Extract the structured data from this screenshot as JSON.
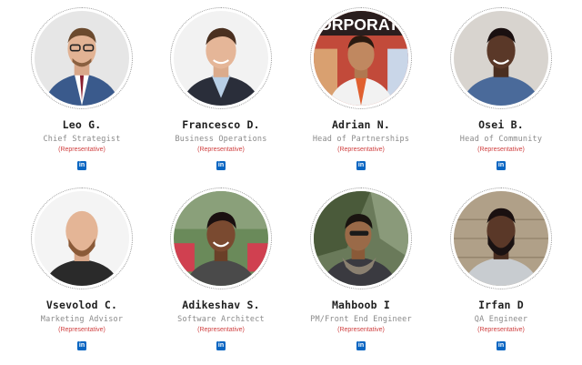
{
  "team": [
    {
      "name": "Leo G.",
      "role": "Chief Strategist",
      "badge": "(Representative)",
      "social": "in"
    },
    {
      "name": "Francesco D.",
      "role": "Business Operations",
      "badge": "(Representative)",
      "social": "in"
    },
    {
      "name": "Adrian N.",
      "role": "Head of Partnerships",
      "badge": "(Representative)",
      "social": "in",
      "photo_text": "ORPORATI"
    },
    {
      "name": "Osei B.",
      "role": "Head of Community",
      "badge": "(Representative)",
      "social": "in"
    },
    {
      "name": "Vsevolod C.",
      "role": "Marketing Advisor",
      "badge": "(Representative)",
      "social": "in"
    },
    {
      "name": "Adikeshav S.",
      "role": "Software Architect",
      "badge": "(Representative)",
      "social": "in"
    },
    {
      "name": "Mahboob I",
      "role": "PM/Front End Engineer",
      "badge": "(Representative)",
      "social": "in"
    },
    {
      "name": "Irfan D",
      "role": "QA Engineer",
      "badge": "(Representative)",
      "social": "in"
    }
  ],
  "colors": {
    "linkedin": "#0a66c2",
    "badge": "#d04040",
    "name": "#1f1f1f",
    "role": "#8a8a8a"
  },
  "icons": {
    "social": "linkedin-icon",
    "photo": "profile-photo"
  }
}
